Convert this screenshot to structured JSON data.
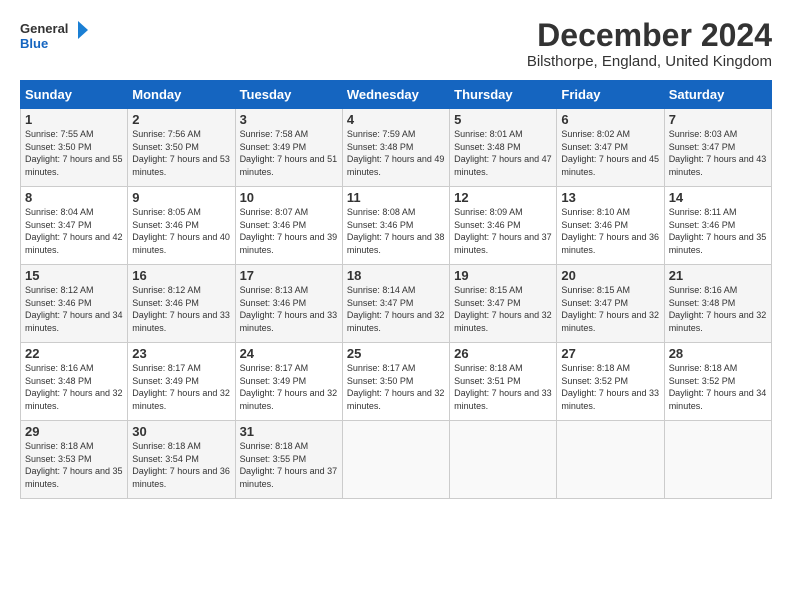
{
  "logo": {
    "line1": "General",
    "line2": "Blue"
  },
  "title": "December 2024",
  "subtitle": "Bilsthorpe, England, United Kingdom",
  "weekdays": [
    "Sunday",
    "Monday",
    "Tuesday",
    "Wednesday",
    "Thursday",
    "Friday",
    "Saturday"
  ],
  "weeks": [
    [
      {
        "day": "1",
        "sunrise": "Sunrise: 7:55 AM",
        "sunset": "Sunset: 3:50 PM",
        "daylight": "Daylight: 7 hours and 55 minutes."
      },
      {
        "day": "2",
        "sunrise": "Sunrise: 7:56 AM",
        "sunset": "Sunset: 3:50 PM",
        "daylight": "Daylight: 7 hours and 53 minutes."
      },
      {
        "day": "3",
        "sunrise": "Sunrise: 7:58 AM",
        "sunset": "Sunset: 3:49 PM",
        "daylight": "Daylight: 7 hours and 51 minutes."
      },
      {
        "day": "4",
        "sunrise": "Sunrise: 7:59 AM",
        "sunset": "Sunset: 3:48 PM",
        "daylight": "Daylight: 7 hours and 49 minutes."
      },
      {
        "day": "5",
        "sunrise": "Sunrise: 8:01 AM",
        "sunset": "Sunset: 3:48 PM",
        "daylight": "Daylight: 7 hours and 47 minutes."
      },
      {
        "day": "6",
        "sunrise": "Sunrise: 8:02 AM",
        "sunset": "Sunset: 3:47 PM",
        "daylight": "Daylight: 7 hours and 45 minutes."
      },
      {
        "day": "7",
        "sunrise": "Sunrise: 8:03 AM",
        "sunset": "Sunset: 3:47 PM",
        "daylight": "Daylight: 7 hours and 43 minutes."
      }
    ],
    [
      {
        "day": "8",
        "sunrise": "Sunrise: 8:04 AM",
        "sunset": "Sunset: 3:47 PM",
        "daylight": "Daylight: 7 hours and 42 minutes."
      },
      {
        "day": "9",
        "sunrise": "Sunrise: 8:05 AM",
        "sunset": "Sunset: 3:46 PM",
        "daylight": "Daylight: 7 hours and 40 minutes."
      },
      {
        "day": "10",
        "sunrise": "Sunrise: 8:07 AM",
        "sunset": "Sunset: 3:46 PM",
        "daylight": "Daylight: 7 hours and 39 minutes."
      },
      {
        "day": "11",
        "sunrise": "Sunrise: 8:08 AM",
        "sunset": "Sunset: 3:46 PM",
        "daylight": "Daylight: 7 hours and 38 minutes."
      },
      {
        "day": "12",
        "sunrise": "Sunrise: 8:09 AM",
        "sunset": "Sunset: 3:46 PM",
        "daylight": "Daylight: 7 hours and 37 minutes."
      },
      {
        "day": "13",
        "sunrise": "Sunrise: 8:10 AM",
        "sunset": "Sunset: 3:46 PM",
        "daylight": "Daylight: 7 hours and 36 minutes."
      },
      {
        "day": "14",
        "sunrise": "Sunrise: 8:11 AM",
        "sunset": "Sunset: 3:46 PM",
        "daylight": "Daylight: 7 hours and 35 minutes."
      }
    ],
    [
      {
        "day": "15",
        "sunrise": "Sunrise: 8:12 AM",
        "sunset": "Sunset: 3:46 PM",
        "daylight": "Daylight: 7 hours and 34 minutes."
      },
      {
        "day": "16",
        "sunrise": "Sunrise: 8:12 AM",
        "sunset": "Sunset: 3:46 PM",
        "daylight": "Daylight: 7 hours and 33 minutes."
      },
      {
        "day": "17",
        "sunrise": "Sunrise: 8:13 AM",
        "sunset": "Sunset: 3:46 PM",
        "daylight": "Daylight: 7 hours and 33 minutes."
      },
      {
        "day": "18",
        "sunrise": "Sunrise: 8:14 AM",
        "sunset": "Sunset: 3:47 PM",
        "daylight": "Daylight: 7 hours and 32 minutes."
      },
      {
        "day": "19",
        "sunrise": "Sunrise: 8:15 AM",
        "sunset": "Sunset: 3:47 PM",
        "daylight": "Daylight: 7 hours and 32 minutes."
      },
      {
        "day": "20",
        "sunrise": "Sunrise: 8:15 AM",
        "sunset": "Sunset: 3:47 PM",
        "daylight": "Daylight: 7 hours and 32 minutes."
      },
      {
        "day": "21",
        "sunrise": "Sunrise: 8:16 AM",
        "sunset": "Sunset: 3:48 PM",
        "daylight": "Daylight: 7 hours and 32 minutes."
      }
    ],
    [
      {
        "day": "22",
        "sunrise": "Sunrise: 8:16 AM",
        "sunset": "Sunset: 3:48 PM",
        "daylight": "Daylight: 7 hours and 32 minutes."
      },
      {
        "day": "23",
        "sunrise": "Sunrise: 8:17 AM",
        "sunset": "Sunset: 3:49 PM",
        "daylight": "Daylight: 7 hours and 32 minutes."
      },
      {
        "day": "24",
        "sunrise": "Sunrise: 8:17 AM",
        "sunset": "Sunset: 3:49 PM",
        "daylight": "Daylight: 7 hours and 32 minutes."
      },
      {
        "day": "25",
        "sunrise": "Sunrise: 8:17 AM",
        "sunset": "Sunset: 3:50 PM",
        "daylight": "Daylight: 7 hours and 32 minutes."
      },
      {
        "day": "26",
        "sunrise": "Sunrise: 8:18 AM",
        "sunset": "Sunset: 3:51 PM",
        "daylight": "Daylight: 7 hours and 33 minutes."
      },
      {
        "day": "27",
        "sunrise": "Sunrise: 8:18 AM",
        "sunset": "Sunset: 3:52 PM",
        "daylight": "Daylight: 7 hours and 33 minutes."
      },
      {
        "day": "28",
        "sunrise": "Sunrise: 8:18 AM",
        "sunset": "Sunset: 3:52 PM",
        "daylight": "Daylight: 7 hours and 34 minutes."
      }
    ],
    [
      {
        "day": "29",
        "sunrise": "Sunrise: 8:18 AM",
        "sunset": "Sunset: 3:53 PM",
        "daylight": "Daylight: 7 hours and 35 minutes."
      },
      {
        "day": "30",
        "sunrise": "Sunrise: 8:18 AM",
        "sunset": "Sunset: 3:54 PM",
        "daylight": "Daylight: 7 hours and 36 minutes."
      },
      {
        "day": "31",
        "sunrise": "Sunrise: 8:18 AM",
        "sunset": "Sunset: 3:55 PM",
        "daylight": "Daylight: 7 hours and 37 minutes."
      },
      null,
      null,
      null,
      null
    ]
  ]
}
